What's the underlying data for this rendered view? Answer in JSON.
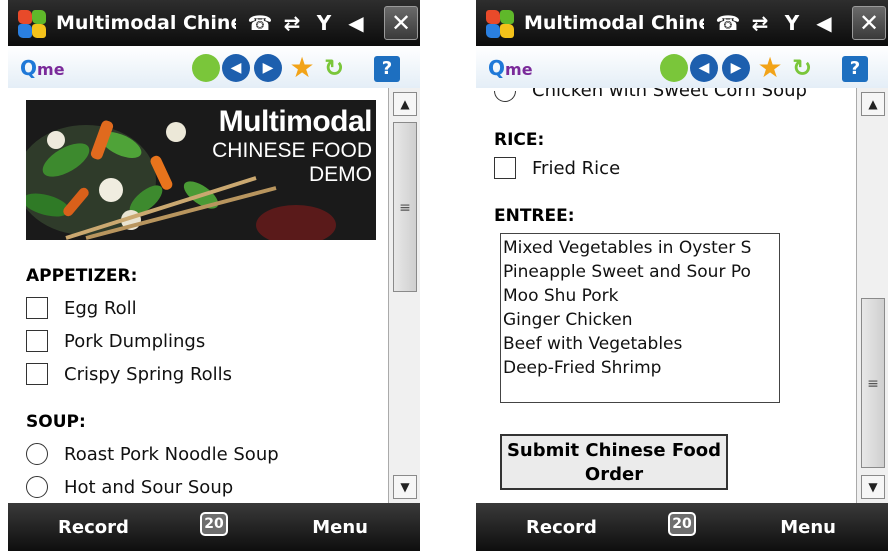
{
  "app": {
    "title": "Multimodal Chine",
    "close_label": "✕",
    "status_icons": [
      "phone-icon",
      "sync-icon",
      "signal-icon",
      "volume-icon"
    ]
  },
  "toolbar": {
    "logo_q": "Q",
    "logo_text": "me",
    "help_label": "?"
  },
  "softkeys": {
    "left": "Record",
    "badge": "20",
    "right": "Menu"
  },
  "screen_left": {
    "banner": {
      "line1": "Multimodal",
      "line2": "CHINESE FOOD",
      "line3": "DEMO"
    },
    "appetizer": {
      "label": "APPETIZER:",
      "options": [
        "Egg Roll",
        "Pork Dumplings",
        "Crispy Spring Rolls"
      ]
    },
    "soup": {
      "label": "SOUP:",
      "options": [
        "Roast Pork Noodle Soup",
        "Hot and Sour Soup"
      ]
    }
  },
  "screen_right": {
    "soup_partial": "Chicken with Sweet Corn Soup",
    "rice": {
      "label": "RICE:",
      "options": [
        "Fried Rice"
      ]
    },
    "entree": {
      "label": "ENTREE:",
      "items": [
        "Mixed Vegetables in Oyster S",
        "Pineapple Sweet and Sour Po",
        "Moo Shu Pork",
        "Ginger Chicken",
        "Beef with Vegetables",
        "Deep-Fried Shrimp"
      ]
    },
    "submit": {
      "line1": "Submit Chinese Food",
      "line2": "Order"
    }
  }
}
